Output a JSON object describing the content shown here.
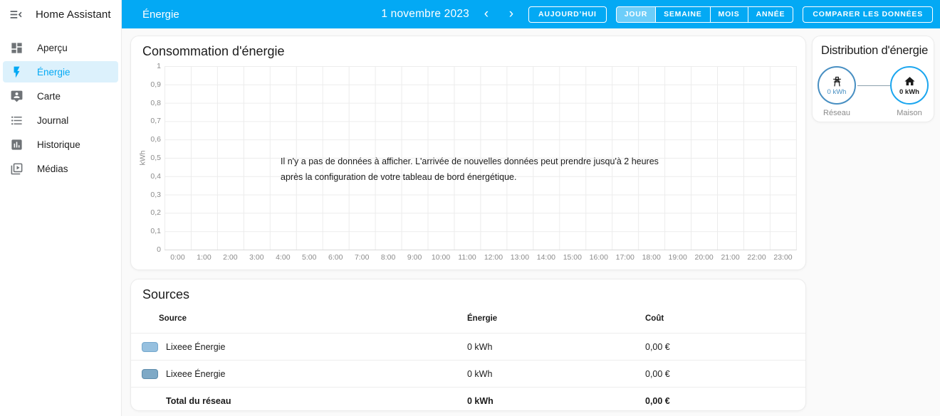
{
  "app": {
    "accent_color": "#03a9f4",
    "grid_node_color": "#488fc2",
    "home_node_color": "#1ba6ef"
  },
  "sidebar": {
    "title": "Home Assistant",
    "items": [
      {
        "label": "Aperçu",
        "icon": "view-dashboard",
        "active": false
      },
      {
        "label": "Énergie",
        "icon": "flash",
        "active": true
      },
      {
        "label": "Carte",
        "icon": "tooltip-account",
        "active": false
      },
      {
        "label": "Journal",
        "icon": "format-list-bulleted",
        "active": false
      },
      {
        "label": "Historique",
        "icon": "chart-box",
        "active": false
      },
      {
        "label": "Médias",
        "icon": "play-box-multiple",
        "active": false
      }
    ]
  },
  "header": {
    "title": "Énergie",
    "date": "1 novembre 2023",
    "prev_label": "‹",
    "next_label": "›",
    "today_button": "AUJOURD’HUI",
    "period_buttons": [
      "JOUR",
      "SEMAINE",
      "MOIS",
      "ANNÉE"
    ],
    "selected_period": "JOUR",
    "compare_button": "COMPARER LES DONNÉES"
  },
  "consumption_card": {
    "title": "Consommation d'énergie",
    "empty_message": "Il n'y a pas de données à afficher. L'arrivée de nouvelles données peut prendre jusqu'à 2 heures après la configuration de votre tableau de bord énergétique.",
    "chart_data": {
      "type": "bar",
      "title": "Consommation d'énergie",
      "xlabel": "",
      "ylabel": "kWh",
      "ylim": [
        0,
        1
      ],
      "grid": true,
      "y_ticks": [
        "1",
        "0,9",
        "0,8",
        "0,7",
        "0,6",
        "0,5",
        "0,4",
        "0,3",
        "0,2",
        "0,1",
        "0"
      ],
      "x_ticks": [
        "0:00",
        "1:00",
        "2:00",
        "3:00",
        "4:00",
        "5:00",
        "6:00",
        "7:00",
        "8:00",
        "9:00",
        "10:00",
        "11:00",
        "12:00",
        "13:00",
        "14:00",
        "15:00",
        "16:00",
        "17:00",
        "18:00",
        "19:00",
        "20:00",
        "21:00",
        "22:00",
        "23:00"
      ],
      "series": []
    }
  },
  "distribution_card": {
    "title": "Distribution d'énergie",
    "nodes": [
      {
        "id": "grid",
        "icon": "transmission-tower",
        "value": "0 kWh",
        "label": "Réseau"
      },
      {
        "id": "home",
        "icon": "home",
        "value": "0 kWh",
        "label": "Maison"
      }
    ]
  },
  "sources_card": {
    "title": "Sources",
    "columns": [
      "Source",
      "Énergie",
      "Coût"
    ],
    "rows": [
      {
        "name": "Lixeee Énergie",
        "energy": "0 kWh",
        "cost": "0,00 €",
        "swatch": "#96c0df",
        "swatch_border": "#74a7cd",
        "bold": false
      },
      {
        "name": "Lixeee Énergie",
        "energy": "0 kWh",
        "cost": "0,00 €",
        "swatch": "#7ea9c6",
        "swatch_border": "#5d8cab",
        "bold": false
      },
      {
        "name": "Total du réseau",
        "energy": "0 kWh",
        "cost": "0,00 €",
        "swatch": null,
        "swatch_border": null,
        "bold": true
      }
    ]
  }
}
